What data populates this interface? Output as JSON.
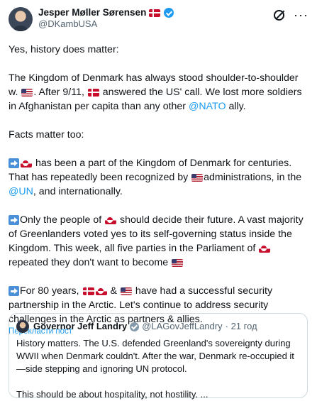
{
  "author": {
    "name": "Jesper Møller Sørensen",
    "handle": "@DKambUSA"
  },
  "post": {
    "p1": "Yes, history does matter:",
    "p2_a": "The Kingdom of Denmark has always stood shoulder-to-shoulder w. ",
    "p2_b": "After 9/11, ",
    "p2_c": " answered the US' call. We lost more soldiers in Afghanistan per capita than any other ",
    "p2_link": "@NATO",
    "p2_d": " ally.",
    "p3": "Facts matter too:",
    "p4_a": " has been a part of the Kingdom of Denmark for centuries. That has repeatedly been recognized by ",
    "p4_b": "administrations, in the ",
    "p4_link": "@UN",
    "p4_c": ", and internationally.",
    "p5_a": "Only the people of ",
    "p5_b": " should decide their future. A vast majority of Greenlanders voted yes to its self-governing status inside the Kingdom. This week, all five parties in the Parliament of ",
    "p5_c": " repeated they don't want to become ",
    "p6_a": "For 80 years, ",
    "p6_b": " & ",
    "p6_c": " have had a successful security partnership in the Arctic. Let's continue to address security challenges in the Arctic as partners & allies."
  },
  "translate_label": "Перекласти пост",
  "quote": {
    "name": "Governor Jeff Landry",
    "handle": "@LAGovJeffLandry",
    "time": "· 21 год",
    "text1": "History matters. The U.S. defended Greenland's sovereignty during WWII when Denmark couldn't. After the war, Denmark re-occupied it—side stepping and ignoring UN protocol.",
    "text2": "This should be about hospitality, not hostility. ..."
  },
  "icons": {
    "verified": "verified-badge",
    "grok": "grok-icon",
    "more": "more-icon",
    "arrow": "right-arrow-emoji",
    "flag_dk": "denmark-flag",
    "flag_us": "us-flag",
    "flag_gl": "greenland-flag"
  },
  "colors": {
    "link": "#1d9bf0",
    "verified": "#1d9bf0",
    "muted": "#536471"
  }
}
